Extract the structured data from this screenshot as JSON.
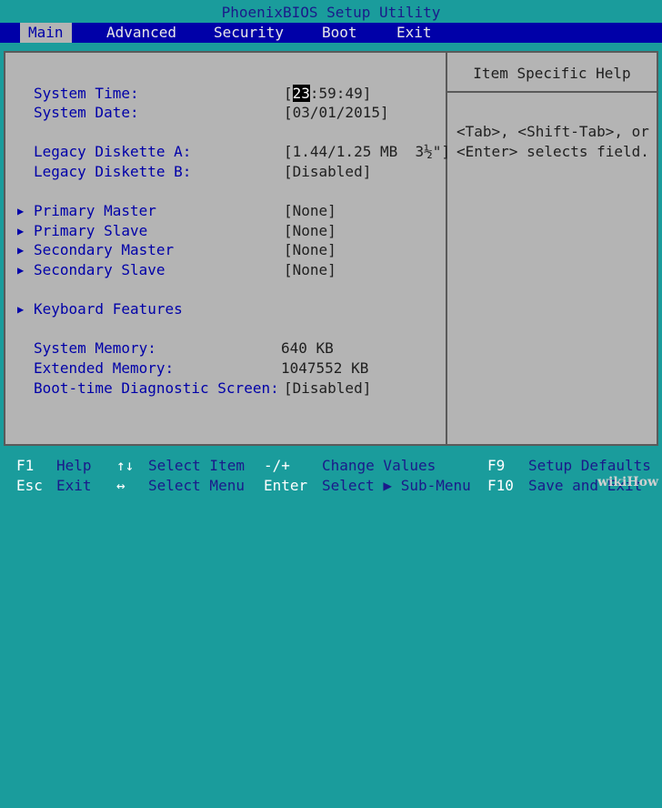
{
  "title": "PhoenixBIOS Setup Utility",
  "menu": [
    "Main",
    "Advanced",
    "Security",
    "Boot",
    "Exit"
  ],
  "fields": {
    "system_time_label": "System Time:",
    "system_time_hour": "23",
    "system_time_rest": ":59:49]",
    "system_date_label": "System Date:",
    "system_date_value": "[03/01/2015]",
    "legacy_a_label": "Legacy Diskette A:",
    "legacy_a_value": "[1.44/1.25 MB  3½\"]",
    "legacy_b_label": "Legacy Diskette B:",
    "legacy_b_value": "[Disabled]",
    "primary_master_label": "Primary Master",
    "primary_master_value": "[None]",
    "primary_slave_label": "Primary Slave",
    "primary_slave_value": "[None]",
    "secondary_master_label": "Secondary Master",
    "secondary_master_value": "[None]",
    "secondary_slave_label": "Secondary Slave",
    "secondary_slave_value": "[None]",
    "keyboard_label": "Keyboard Features",
    "system_memory_label": "System Memory:",
    "system_memory_value": "640 KB",
    "extended_memory_label": "Extended Memory:",
    "extended_memory_value": "1047552 KB",
    "boot_diag_label": "Boot-time Diagnostic Screen:",
    "boot_diag_value": "[Disabled]"
  },
  "help": {
    "title": "Item Specific Help",
    "line1": "<Tab>, <Shift-Tab>, or",
    "line2": "<Enter> selects field."
  },
  "footer": {
    "f1": "F1",
    "help": "Help",
    "arrows_ud": "↑↓",
    "select_item": "Select Item",
    "minus_plus": "-/+",
    "change_values": "Change Values",
    "f9": "F9",
    "setup_defaults": "Setup Defaults",
    "esc": "Esc",
    "exit": "Exit",
    "arrows_lr": "↔",
    "select_menu": "Select Menu",
    "enter": "Enter",
    "select_submenu": "Select ▶ Sub-Menu",
    "f10": "F10",
    "save_exit": "Save and Exit"
  },
  "watermark": "wikiHow",
  "colors": {
    "background": "#1a9c9c",
    "menu_bar": "#0000a8",
    "panel": "#b4b4b4",
    "label": "#0000a8"
  }
}
